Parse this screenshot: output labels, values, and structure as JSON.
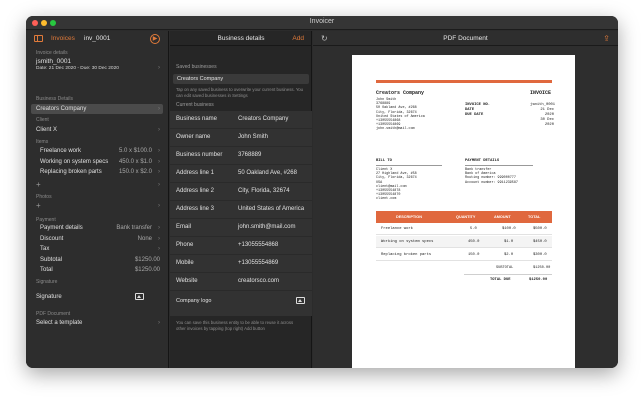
{
  "app": {
    "title": "Invoicer"
  },
  "sidebar": {
    "tab": "Invoices",
    "invoice_number": "inv_0001",
    "sections": {
      "invoice_details": "Invoice details",
      "business_details": "Business Details",
      "client": "Client",
      "items": "Items",
      "photos": "Photos",
      "payment": "Payment",
      "signature": "Signature",
      "pdf_document": "PDF Document"
    },
    "invoice": {
      "name": "jsmith_0001",
      "dates": "Date: 21 Dec 2020 - Due: 30 Dec 2020"
    },
    "business": "Creators Company",
    "client": "Client X",
    "items": [
      {
        "name": "Freelance work",
        "value": "5.0 x $100.0"
      },
      {
        "name": "Working on system specs",
        "value": "450.0 x $1.0"
      },
      {
        "name": "Replacing broken parts",
        "value": "150.0 x $2.0"
      }
    ],
    "payment": [
      {
        "label": "Payment details",
        "value": "Bank transfer"
      },
      {
        "label": "Discount",
        "value": "None"
      },
      {
        "label": "Tax",
        "value": ""
      },
      {
        "label": "Subtotal",
        "value": "$1250.00"
      },
      {
        "label": "Total",
        "value": "$1250.00"
      }
    ],
    "signature_label": "Signature",
    "template_label": "Select a template"
  },
  "business_panel": {
    "title": "Business details",
    "add_label": "Add",
    "saved_header": "Saved businesses",
    "saved_item": "Creators Company",
    "saved_note": "Tap on any saved business to overwrite your current business. You can edit saved businesses in Settings",
    "current_header": "Current business",
    "fields": [
      {
        "label": "Business name",
        "value": "Creators Company"
      },
      {
        "label": "Owner name",
        "value": "John Smith"
      },
      {
        "label": "Business number",
        "value": "3768889"
      },
      {
        "label": "Address line 1",
        "value": "50 Oakland Ave, #268"
      },
      {
        "label": "Address line 2",
        "value": "City, Florida, 32674"
      },
      {
        "label": "Address line 3",
        "value": "United States of America"
      },
      {
        "label": "Email",
        "value": "john.smith@mail.com"
      },
      {
        "label": "Phone",
        "value": "+13055554868"
      },
      {
        "label": "Mobile",
        "value": "+13055554869"
      },
      {
        "label": "Website",
        "value": "creatorsco.com"
      }
    ],
    "logo_label": "Company logo",
    "footer_note": "You can save this business entity to be able to reuse it across other invoices by tapping (top right) Add button"
  },
  "pdf": {
    "title": "PDF Document",
    "company": "Creators Company",
    "invoice_heading": "INVOICE",
    "from_lines": [
      "John Smith",
      "3768889",
      "50 Oakland Ave, #268",
      "City, Florida, 32674",
      "United States of America",
      "+13055554868",
      "+13055554869",
      "john.smith@mail.com"
    ],
    "meta_labels": [
      "INVOICE NO.",
      "DATE",
      "DUE DATE"
    ],
    "meta_values": [
      "jsmith_0001",
      "21 Dec 2020",
      "30 Dec 2020"
    ],
    "bill_to_label": "BILL TO",
    "bill_to_lines": [
      "Client X",
      "27 Highland Ave, #58",
      "City, Florida, 32674",
      "USA",
      "client@mail.com",
      "+13055554878",
      "+13055554870",
      "client.com"
    ],
    "payment_label": "PAYMENT DETAILS",
    "payment_lines": [
      "Bank transfer",
      "Bank of America",
      "Routing number: 999000777",
      "Account number: 9911239587"
    ],
    "table_headers": [
      "DESCRIPTION",
      "QUANTITY",
      "AMOUNT",
      "TOTAL"
    ],
    "table_rows": [
      [
        "Freelance work",
        "5.0",
        "$100.0",
        "$500.0"
      ],
      [
        "Working on system specs",
        "450.0",
        "$1.0",
        "$450.0"
      ],
      [
        "Replacing broken parts",
        "150.0",
        "$2.0",
        "$300.0"
      ]
    ],
    "subtotal_label": "SUBTOTAL",
    "subtotal_value": "$1250.00",
    "total_due_label": "TOTAL DUE",
    "total_due_value": "$1250.00"
  },
  "colors": {
    "accent": "#e0683e",
    "window": "#2b2b2b"
  }
}
